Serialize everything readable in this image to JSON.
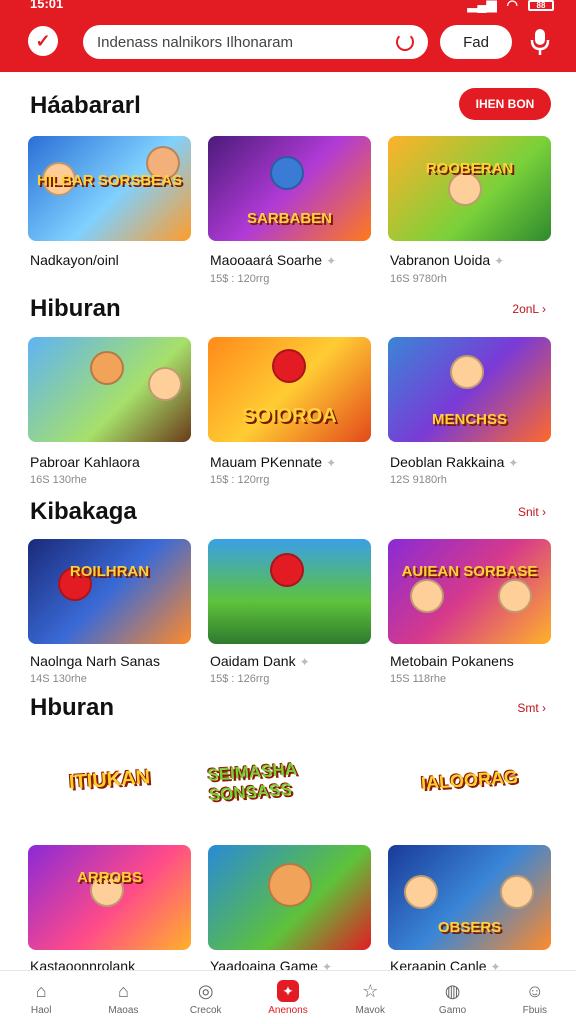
{
  "status_bar": {
    "time": "15:01",
    "battery": "88"
  },
  "header": {
    "search_text": "Indenass nalnikors Ilhonaram",
    "find_label": "Fad"
  },
  "sections": [
    {
      "title": "Háabararl",
      "see_all": "IHEN BON",
      "games": [
        {
          "banner": "HILBAR SORSBEAS",
          "name": "Nadkayon/oinl",
          "meta": ""
        },
        {
          "banner": "SARBABEN",
          "name": "Maooaará Soarhe",
          "meta": "15$ : 120rrg"
        },
        {
          "banner": "ROOBERAN",
          "name": "Vabranon Uoida",
          "meta": "16S 9780rh"
        }
      ]
    },
    {
      "title": "Hiburan",
      "see_all": "2onL",
      "games": [
        {
          "banner": "",
          "name": "Pabroar Kahlaora",
          "meta": "16S 130rhe"
        },
        {
          "banner": "SOIOROA",
          "name": "Mauam PKennate",
          "meta": "15$ : 120rrg"
        },
        {
          "banner": "MENCHSS",
          "name": "Deoblan Rakkaina",
          "meta": "12S 9180rh"
        }
      ]
    },
    {
      "title": "Kibakaga",
      "see_all": "Snit",
      "games": [
        {
          "banner": "ROILHRAN",
          "name": "Naolnga Narh Sanas",
          "meta": "14S 130rhe"
        },
        {
          "banner": "",
          "name": "Oaidam Dank",
          "meta": "15$ : 126rrg"
        },
        {
          "banner": "AUIEAN SORBASE",
          "name": "Metobain Pokanens",
          "meta": "15S 118rhe"
        }
      ]
    },
    {
      "title": "Hburan",
      "see_all": "Smt",
      "logos": [
        "ITIUKAN",
        "SEIMASHA SONSASS",
        "IALOORAG"
      ],
      "games": [
        {
          "banner": "ARROBS",
          "name": "Kastaoonnrolank",
          "meta": ""
        },
        {
          "banner": "",
          "name": "Yaadoaina Game",
          "meta": ""
        },
        {
          "banner": "OBSERS",
          "name": "Keraapin Canle",
          "meta": ""
        }
      ]
    }
  ],
  "bottom_nav": [
    {
      "label": "Haol",
      "icon": "home-icon"
    },
    {
      "label": "Maoas",
      "icon": "house-icon"
    },
    {
      "label": "Crecok",
      "icon": "compass-icon"
    },
    {
      "label": "Anenons",
      "icon": "star-active-icon"
    },
    {
      "label": "Mavok",
      "icon": "star-icon"
    },
    {
      "label": "Gamo",
      "icon": "controller-icon"
    },
    {
      "label": "Fbuis",
      "icon": "profile-icon"
    }
  ],
  "colors": {
    "brand": "#e31b23"
  }
}
